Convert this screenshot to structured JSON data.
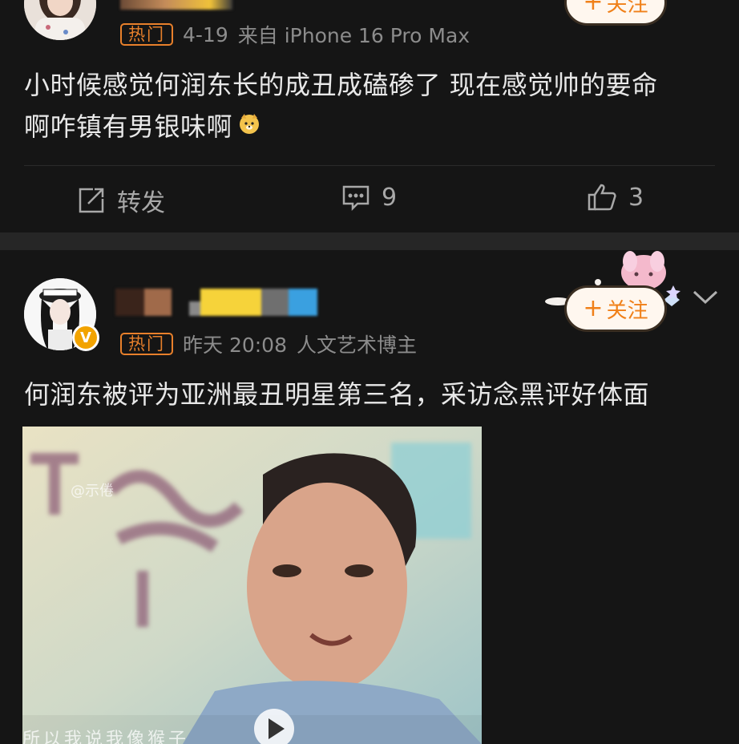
{
  "post1": {
    "hot_label": "热门",
    "date": "4-19",
    "source": "来自 iPhone 16 Pro Max",
    "follow_label": "关注",
    "text_line1": "小时候感觉何润东长的成丑成磕碜了 现在感觉帅的要命",
    "text_line2": "啊咋镇有男银味啊",
    "emoji_icon": "dog-face-emoji",
    "repost_label": "转发",
    "comment_count": "9",
    "like_count": "3"
  },
  "post2": {
    "hot_label": "热门",
    "time": "昨天 20:08",
    "user_tag": "人文艺术博主",
    "follow_label": "关注",
    "verified_badge": "V",
    "text": "何润东被评为亚洲最丑明星第三名，采访念黑评好体面",
    "video_watermark": "@示倦",
    "video_subtitle": "所以我说我像猴子"
  },
  "colors": {
    "accent": "#f08019",
    "hot_badge": "#e8802b",
    "background": "#151515",
    "verified": "#f2a300"
  }
}
